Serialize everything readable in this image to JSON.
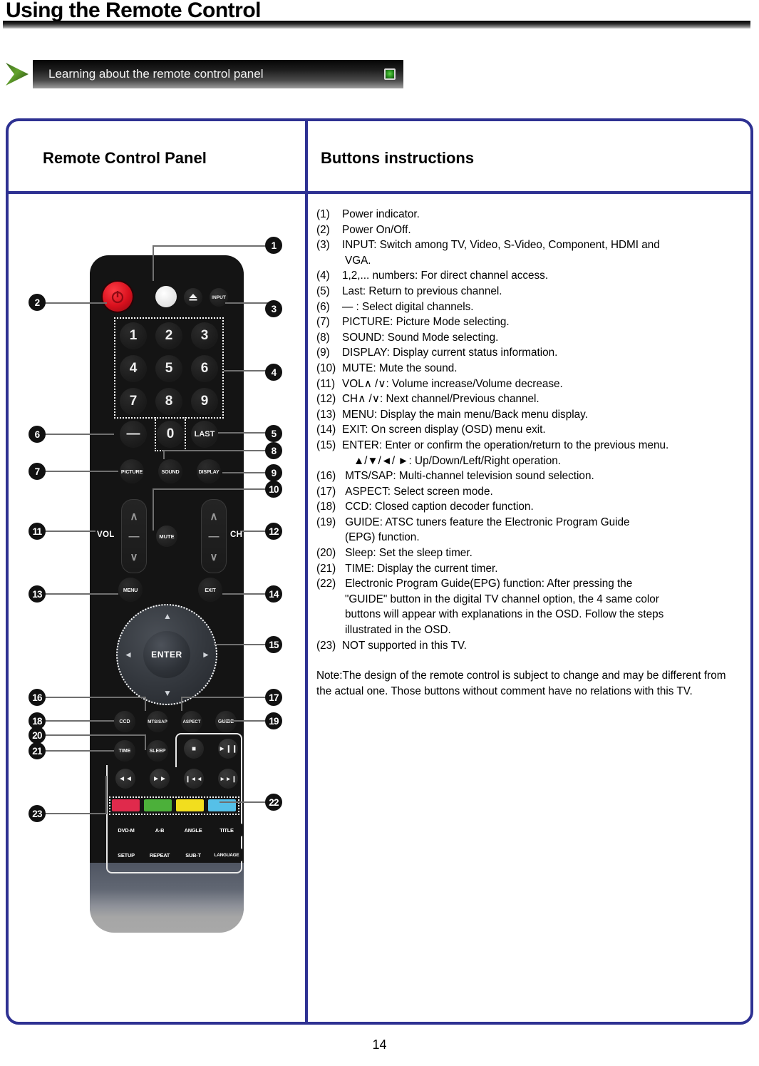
{
  "page": {
    "title": "Using the Remote Control",
    "number": "14"
  },
  "banner": {
    "label": "Learning about the remote control panel",
    "arrow_icon": "green-chevron-icon",
    "chip_icon": "green-square-indicator-icon",
    "chip_color": "#2f9a24"
  },
  "table": {
    "accent_color": "#2e3192",
    "header_left": "Remote Control Panel",
    "header_right": "Buttons instructions"
  },
  "instructions": [
    {
      "num": "(1)",
      "text": "Power indicator."
    },
    {
      "num": "(2)",
      "text": "Power On/Off."
    },
    {
      "num": "(3)",
      "text": "INPUT: Switch among TV, Video, S-Video, Component, HDMI and"
    },
    {
      "cont": " VGA."
    },
    {
      "num": "(4)",
      "text": "1,2,... numbers: For direct channel access."
    },
    {
      "num": "(5)",
      "text": "Last: Return to previous channel."
    },
    {
      "num": "(6)",
      "text": "— : Select digital channels."
    },
    {
      "num": "(7)",
      "text": "PICTURE: Picture Mode selecting."
    },
    {
      "num": "(8)",
      "text": "SOUND: Sound Mode selecting."
    },
    {
      "num": "(9)",
      "text": "DISPLAY: Display current status information."
    },
    {
      "num": "(10)",
      "text": "MUTE: Mute the sound."
    },
    {
      "num": "(11)",
      "text": "VOL∧ /∨: Volume increase/Volume decrease."
    },
    {
      "num": "(12)",
      "text": "CH∧ /∨: Next channel/Previous channel."
    },
    {
      "num": "(13)",
      "text": "MENU: Display the main menu/Back menu display."
    },
    {
      "num": "(14)",
      "text": "EXIT: On screen display (OSD) menu exit."
    },
    {
      "num": "(15)",
      "text": "ENTER: Enter or confirm the operation/return to the previous menu."
    },
    {
      "cont_deep": "▲/▼/◄/ ►: Up/Down/Left/Right operation."
    },
    {
      "num": "(16)",
      "text": " MTS/SAP: Multi-channel television sound selection."
    },
    {
      "num": "(17)",
      "text": " ASPECT: Select screen mode."
    },
    {
      "num": "(18)",
      "text": " CCD: Closed caption decoder function."
    },
    {
      "num": "(19)",
      "text": " GUIDE: ATSC tuners feature the Electronic Program Guide"
    },
    {
      "cont": " (EPG) function."
    },
    {
      "num": "(20)",
      "text": " Sleep: Set the sleep timer."
    },
    {
      "num": "(21)",
      "text": " TIME: Display the current timer."
    },
    {
      "num": "(22)",
      "text": " Electronic Program Guide(EPG) function: After pressing the"
    },
    {
      "cont": "\"GUIDE\" button in the digital TV channel option, the 4 same color"
    },
    {
      "cont": " buttons will appear with explanations in the OSD. Follow the steps"
    },
    {
      "cont": " illustrated in the OSD."
    },
    {
      "num": "(23)",
      "text": "NOT supported in this TV."
    }
  ],
  "note": "Note:The design of the remote control is subject to change and may be different from the actual one. Those buttons without comment have no relations with this TV.",
  "remote": {
    "power_button": "power-icon",
    "led_indicator": "power-indicator-led",
    "eject_button": "eject-icon",
    "input_button": "INPUT",
    "numbers": [
      "1",
      "2",
      "3",
      "4",
      "5",
      "6",
      "7",
      "8",
      "9"
    ],
    "dash_button": "—",
    "zero_button": "0",
    "last_button": "LAST",
    "picture_button": "PICTURE",
    "sound_button": "SOUND",
    "display_button": "DISPLAY",
    "vol_label": "VOL",
    "ch_label": "CH",
    "rocker_up": "∧",
    "rocker_mid": "—",
    "rocker_down": "∨",
    "mute_button": "MUTE",
    "menu_button": "MENU",
    "exit_button": "EXIT",
    "enter_button": "ENTER",
    "nav_up": "▲",
    "nav_down": "▼",
    "nav_left": "◄",
    "nav_right": "►",
    "ccd_button": "CCD",
    "mtssap_button": "MTS/SAP",
    "aspect_button": "ASPECT",
    "guide_button": "GUIDE",
    "time_button": "TIME",
    "sleep_button": "SLEEP",
    "stop_button": "■",
    "playpause_button": "►❙❙",
    "rewind_button": "◄◄",
    "forward_button": "►►",
    "prev_button": "❙◄◄",
    "next_button": "►►❙",
    "color_buttons": [
      {
        "name": "red",
        "color": "#e02a4c"
      },
      {
        "name": "green",
        "color": "#4cb03a"
      },
      {
        "name": "yellow",
        "color": "#f2de1e"
      },
      {
        "name": "blue",
        "color": "#56c0e8"
      }
    ],
    "dvd_row1": [
      "DVD-M",
      "A-B",
      "ANGLE",
      "TITLE"
    ],
    "dvd_row2": [
      "SETUP",
      "REPEAT",
      "SUB-T",
      "LANGUAGE"
    ]
  },
  "callouts": [
    {
      "id": "1",
      "label": "1"
    },
    {
      "id": "2",
      "label": "2"
    },
    {
      "id": "3",
      "label": "3"
    },
    {
      "id": "4",
      "label": "4"
    },
    {
      "id": "5",
      "label": "5"
    },
    {
      "id": "6",
      "label": "6"
    },
    {
      "id": "7",
      "label": "7"
    },
    {
      "id": "8",
      "label": "8"
    },
    {
      "id": "9",
      "label": "9"
    },
    {
      "id": "10",
      "label": "10"
    },
    {
      "id": "11",
      "label": "11"
    },
    {
      "id": "12",
      "label": "12"
    },
    {
      "id": "13",
      "label": "13"
    },
    {
      "id": "14",
      "label": "14"
    },
    {
      "id": "15",
      "label": "15"
    },
    {
      "id": "16",
      "label": "16"
    },
    {
      "id": "17",
      "label": "17"
    },
    {
      "id": "18",
      "label": "18"
    },
    {
      "id": "19",
      "label": "19"
    },
    {
      "id": "20",
      "label": "20"
    },
    {
      "id": "21",
      "label": "21"
    },
    {
      "id": "22",
      "label": "22"
    },
    {
      "id": "23",
      "label": "23"
    }
  ]
}
